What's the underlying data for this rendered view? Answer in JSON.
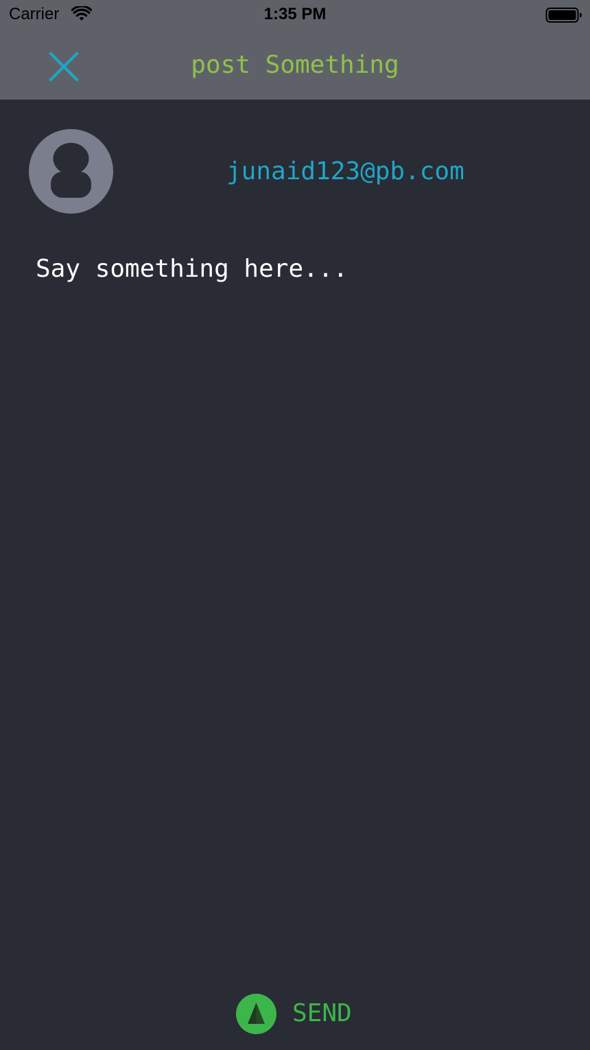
{
  "status_bar": {
    "carrier": "Carrier",
    "time": "1:35 PM"
  },
  "nav": {
    "title": "post Something",
    "close_icon": "close-icon"
  },
  "user": {
    "email": "junaid123@pb.com",
    "avatar_icon": "person-icon"
  },
  "composer": {
    "placeholder": "Say something here...",
    "value": ""
  },
  "send": {
    "label": "SEND",
    "icon": "send-icon"
  },
  "colors": {
    "background": "#292b35",
    "topbar": "#5f6169",
    "title_green": "#8ec24a",
    "accent_teal": "#1ea7c6",
    "send_green": "#3cb64a",
    "avatar_gray": "#7b7e8c"
  }
}
